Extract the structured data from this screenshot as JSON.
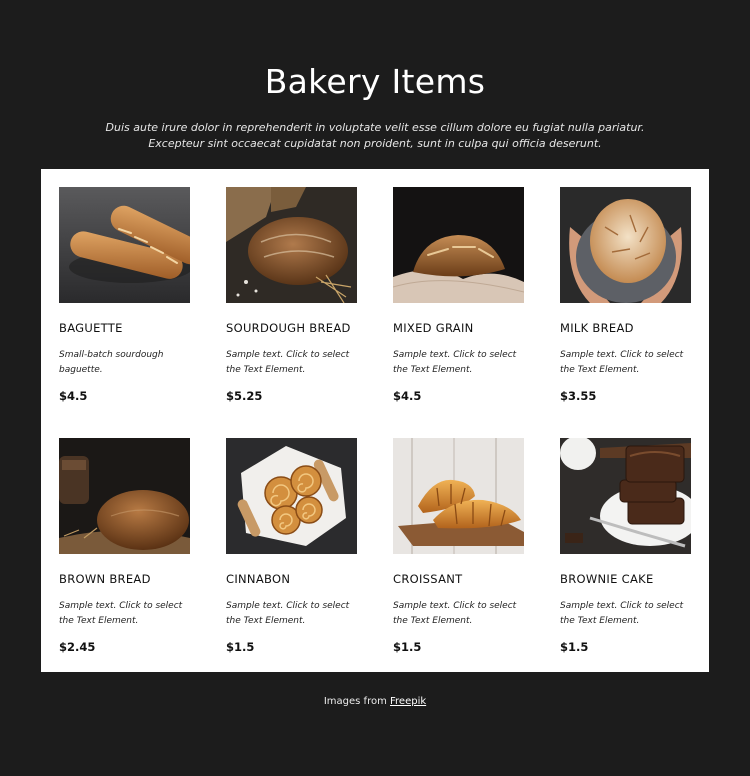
{
  "header": {
    "title": "Bakery Items",
    "subtitle_line1": "Duis aute irure dolor in reprehenderit in voluptate velit esse cillum dolore eu fugiat nulla pariatur.",
    "subtitle_line2": "Excepteur sint occaecat cupidatat non proident, sunt in culpa qui officia deserunt."
  },
  "items": [
    {
      "name": "BAGUETTE",
      "desc": "Small-batch sourdough baguette.",
      "price": "$4.5",
      "image": "baguette-photo"
    },
    {
      "name": "SOURDOUGH BREAD",
      "desc": "Sample text. Click to select the Text Element.",
      "price": "$5.25",
      "image": "sourdough-photo"
    },
    {
      "name": "MIXED GRAIN",
      "desc": "Sample text. Click to select the Text Element.",
      "price": "$4.5",
      "image": "mixed-grain-photo"
    },
    {
      "name": "MILK BREAD",
      "desc": "Sample text. Click to select the Text Element.",
      "price": "$3.55",
      "image": "milk-bread-photo"
    },
    {
      "name": "BROWN BREAD",
      "desc": "Sample text. Click to select the Text Element.",
      "price": "$2.45",
      "image": "brown-bread-photo"
    },
    {
      "name": "CINNABON",
      "desc": "Sample text. Click to select the Text Element.",
      "price": "$1.5",
      "image": "cinnabon-photo"
    },
    {
      "name": "CROISSANT",
      "desc": "Sample text. Click to select the Text Element.",
      "price": "$1.5",
      "image": "croissant-photo"
    },
    {
      "name": "BROWNIE CAKE",
      "desc": "Sample text. Click to select the Text Element.",
      "price": "$1.5",
      "image": "brownie-cake-photo"
    }
  ],
  "footer": {
    "prefix": "Images from",
    "link_label": "Freepik"
  }
}
